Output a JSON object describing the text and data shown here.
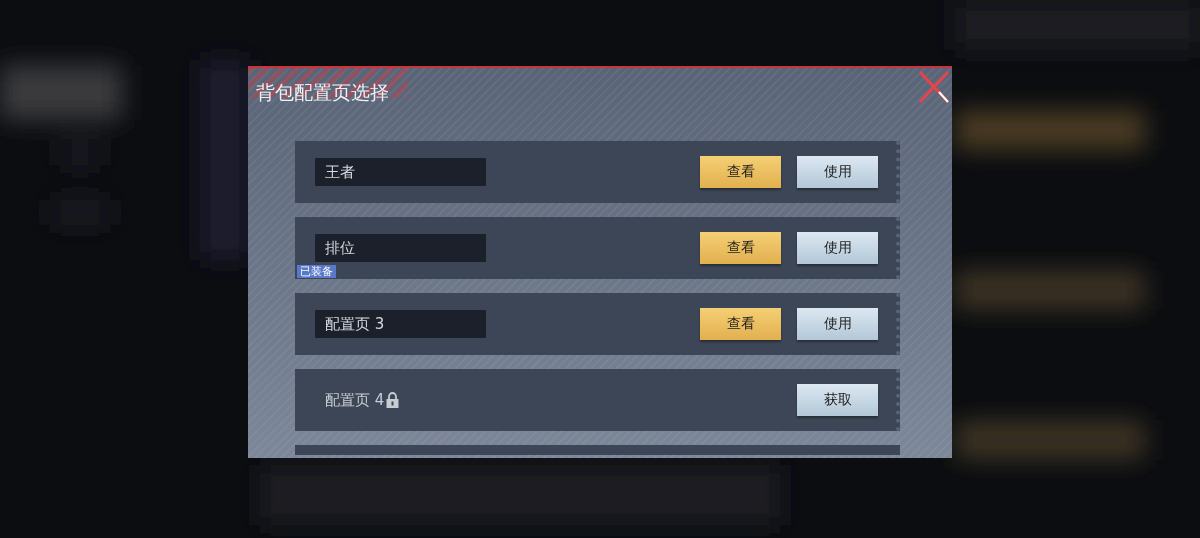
{
  "dialog": {
    "title": "背包配置页选择"
  },
  "loadouts": [
    {
      "kind": "editable",
      "name": "王者",
      "buttons": [
        {
          "label": "查看",
          "kind": "view"
        },
        {
          "label": "使用",
          "kind": "use"
        }
      ]
    },
    {
      "kind": "editable",
      "name": "排位",
      "badge": "已装备",
      "buttons": [
        {
          "label": "查看",
          "kind": "view"
        },
        {
          "label": "使用",
          "kind": "use"
        }
      ]
    },
    {
      "kind": "editable",
      "name": "配置页 3",
      "buttons": [
        {
          "label": "查看",
          "kind": "view"
        },
        {
          "label": "使用",
          "kind": "use"
        }
      ]
    },
    {
      "kind": "locked",
      "name": "配置页 4",
      "buttons": [
        {
          "label": "获取",
          "kind": "use"
        }
      ]
    }
  ]
}
